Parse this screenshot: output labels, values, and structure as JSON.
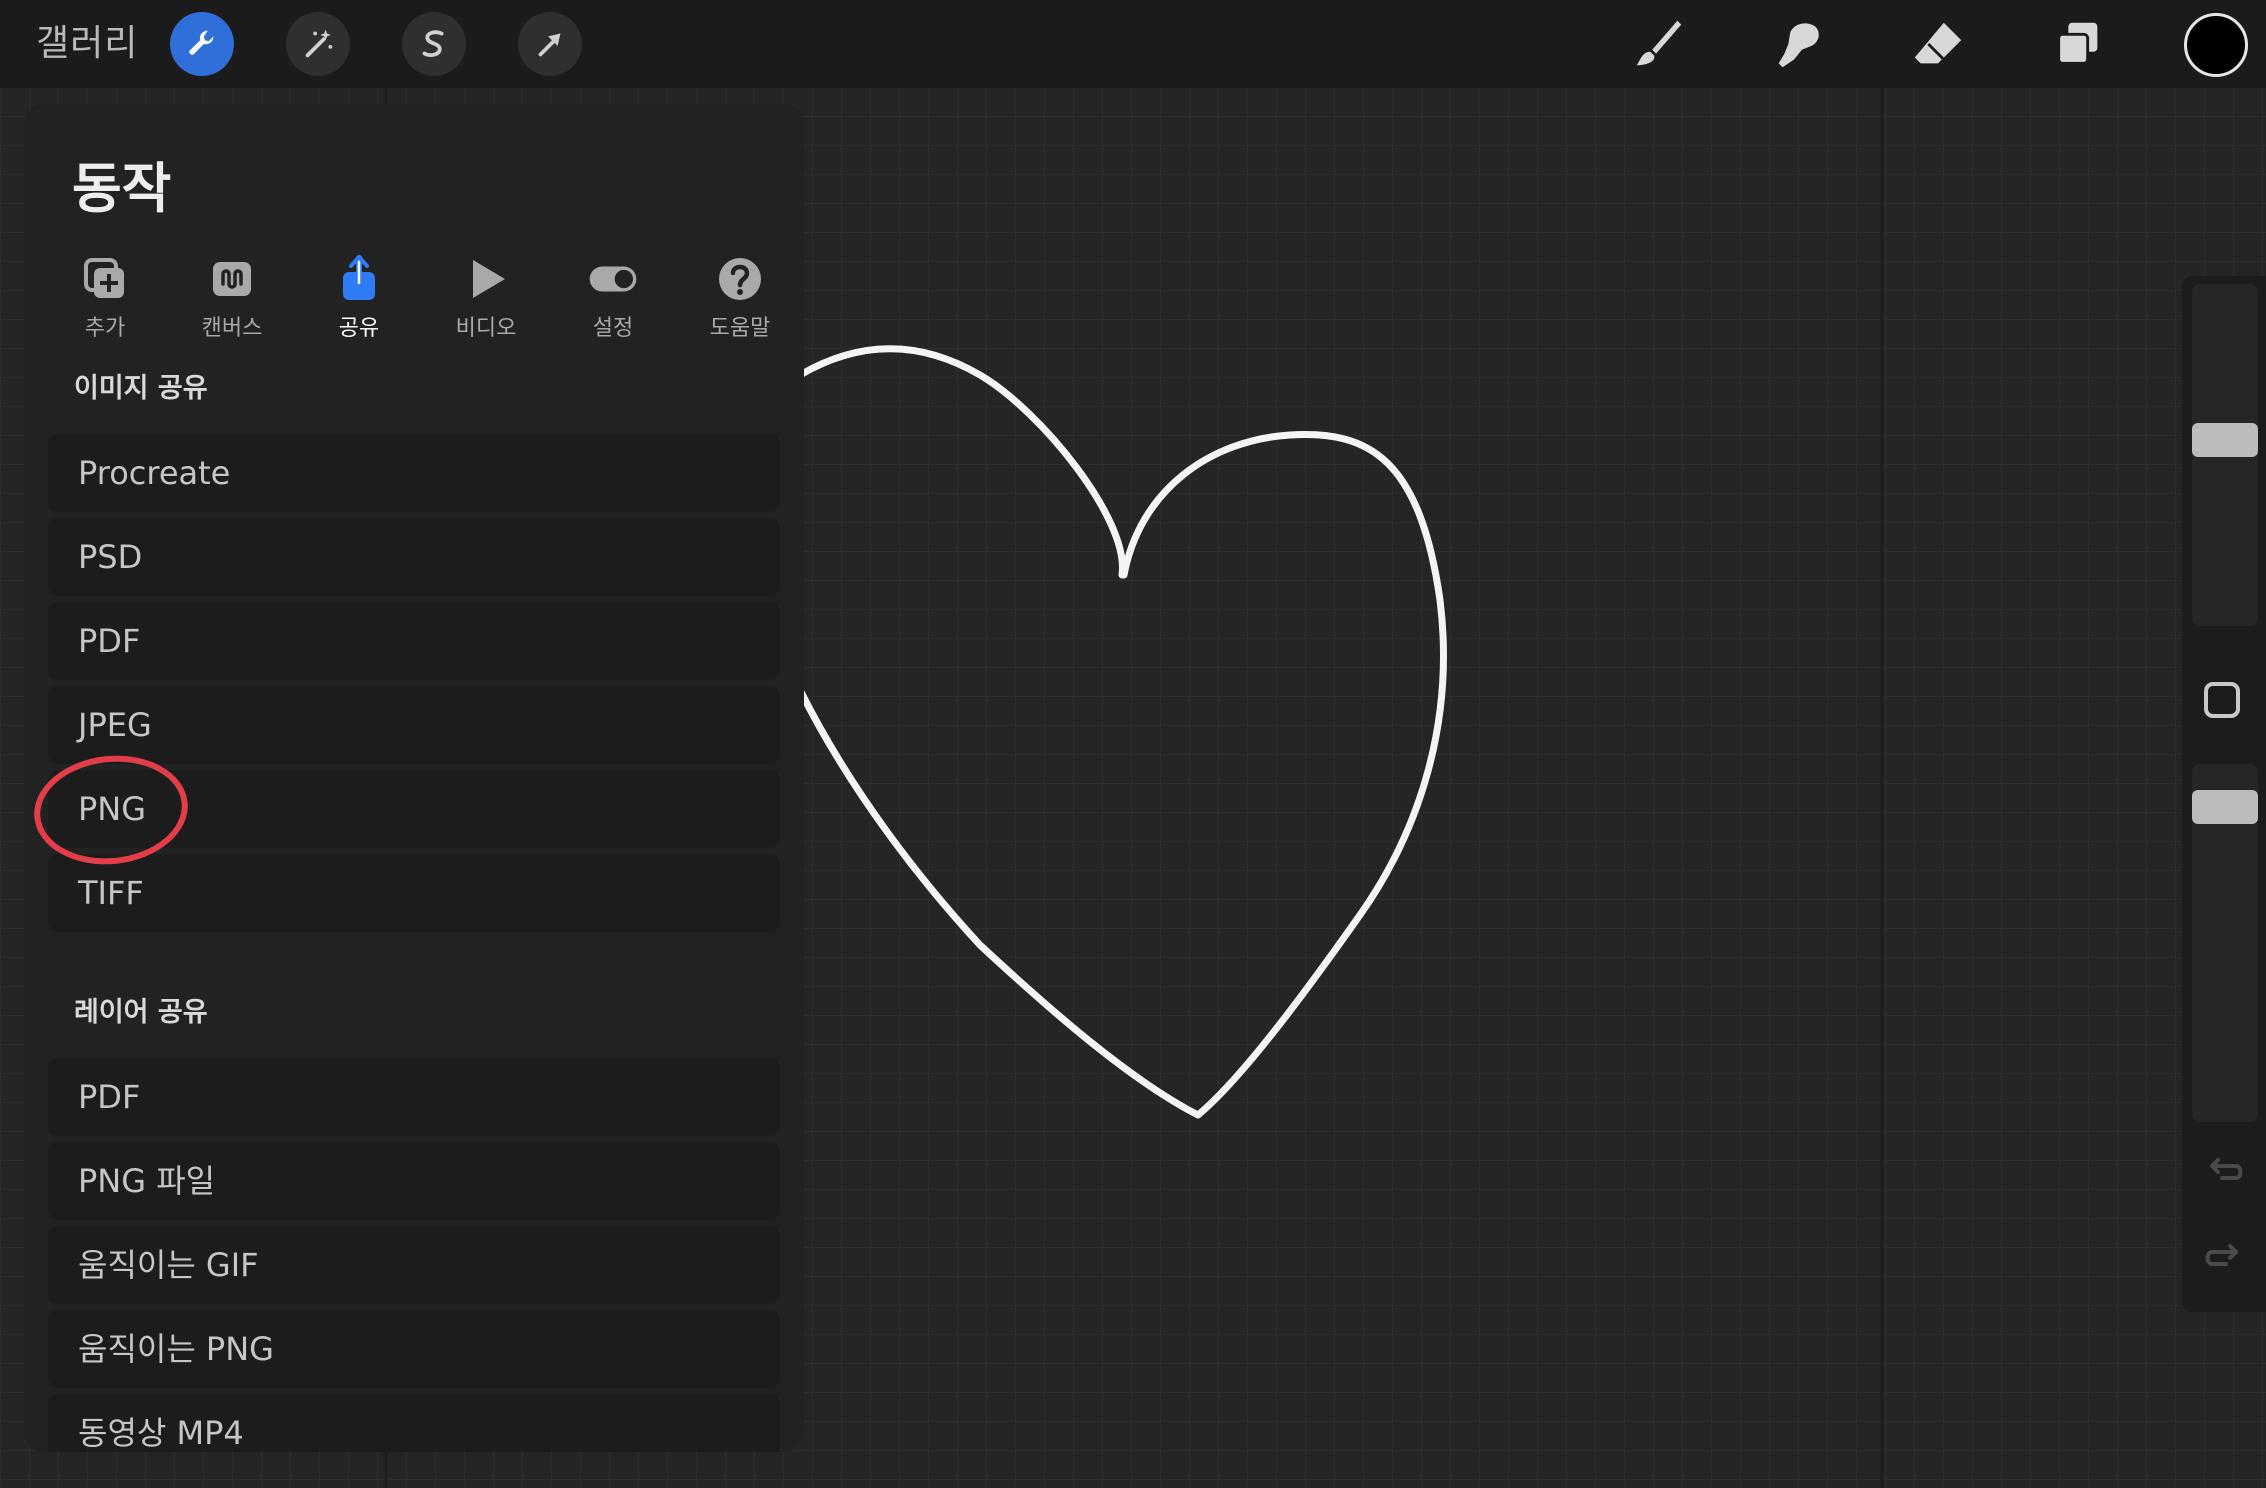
{
  "topbar": {
    "gallery_label": "갤러리",
    "left_tools": [
      {
        "name": "actions",
        "icon": "wrench-icon",
        "active": true
      },
      {
        "name": "adjustments",
        "icon": "magic-wand-icon",
        "active": false
      },
      {
        "name": "selection",
        "icon": "selection-s-icon",
        "active": false
      },
      {
        "name": "transform",
        "icon": "arrow-cursor-icon",
        "active": false
      }
    ],
    "right_tools": [
      {
        "name": "brush",
        "icon": "brush-icon"
      },
      {
        "name": "smudge",
        "icon": "smudge-icon"
      },
      {
        "name": "eraser",
        "icon": "eraser-icon"
      },
      {
        "name": "layers",
        "icon": "layers-icon"
      }
    ],
    "current_color": "#000000",
    "accent_color": "#2f6fd9"
  },
  "panel": {
    "title": "동작",
    "tabs": [
      {
        "label": "추가",
        "icon": "add-icon",
        "active": false
      },
      {
        "label": "캔버스",
        "icon": "canvas-icon",
        "active": false
      },
      {
        "label": "공유",
        "icon": "share-icon",
        "active": true
      },
      {
        "label": "비디오",
        "icon": "play-icon",
        "active": false
      },
      {
        "label": "설정",
        "icon": "toggle-icon",
        "active": false
      },
      {
        "label": "도움말",
        "icon": "help-icon",
        "active": false
      }
    ],
    "image_share": {
      "header": "이미지 공유",
      "items": [
        "Procreate",
        "PSD",
        "PDF",
        "JPEG",
        "PNG",
        "TIFF"
      ]
    },
    "layer_share": {
      "header": "레이어 공유",
      "items": [
        "PDF",
        "PNG 파일",
        "움직이는 GIF",
        "움직이는 PNG",
        "동영상 MP4"
      ]
    },
    "highlighted_item": "PNG",
    "highlight_color": "#e43d4a"
  },
  "sidebar": {
    "brush_size_level": 0.45,
    "opacity_level": 0.08
  },
  "canvas": {
    "background": "#252525",
    "drawing": "heart-outline",
    "stroke_color": "#ffffff"
  }
}
